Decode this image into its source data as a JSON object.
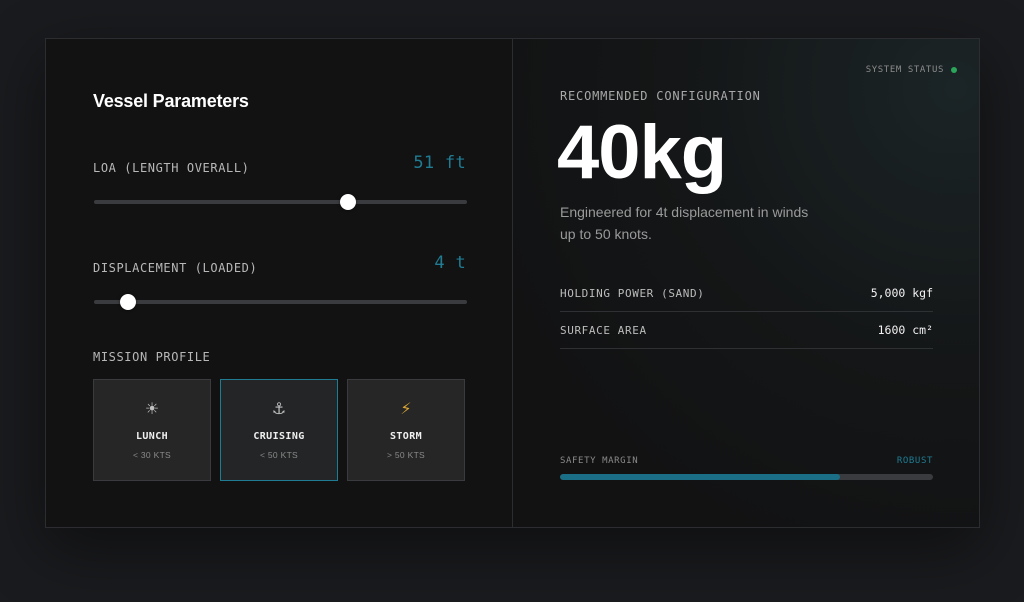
{
  "left_panel": {
    "title": "Vessel Parameters",
    "loa": {
      "label": "LOA (LENGTH OVERALL)",
      "value": "51 ft",
      "slider_fraction": 0.68
    },
    "displacement": {
      "label": "DISPLACEMENT (LOADED)",
      "value": "4 t",
      "slider_fraction": 0.09
    },
    "mission_profile": {
      "label": "MISSION PROFILE",
      "options": [
        {
          "name": "LUNCH",
          "range": "< 30 KTS",
          "icon": "sun-icon",
          "glyph": "☀",
          "selected": false
        },
        {
          "name": "CRUISING",
          "range": "< 50 KTS",
          "icon": "anchor-icon",
          "glyph": "⚓",
          "selected": true
        },
        {
          "name": "STORM",
          "range": "> 50 KTS",
          "icon": "lightning-icon",
          "glyph": "⚡",
          "selected": false
        }
      ]
    }
  },
  "right_panel": {
    "system_status": "SYSTEM STATUS",
    "recommended_label": "RECOMMENDED CONFIGURATION",
    "recommended_value": "40kg",
    "description": "Engineered for 4t displacement in winds up to 50 knots.",
    "specs": [
      {
        "key": "HOLDING POWER (SAND)",
        "value": "5,000 kgf"
      },
      {
        "key": "SURFACE AREA",
        "value": "1600 cm²"
      }
    ],
    "safety_margin": {
      "label": "SAFETY MARGIN",
      "value": "ROBUST",
      "fraction": 0.75
    }
  },
  "colors": {
    "accent": "#1f7c93",
    "status_ok": "#2aa55a",
    "bolt": "#d9a431"
  }
}
